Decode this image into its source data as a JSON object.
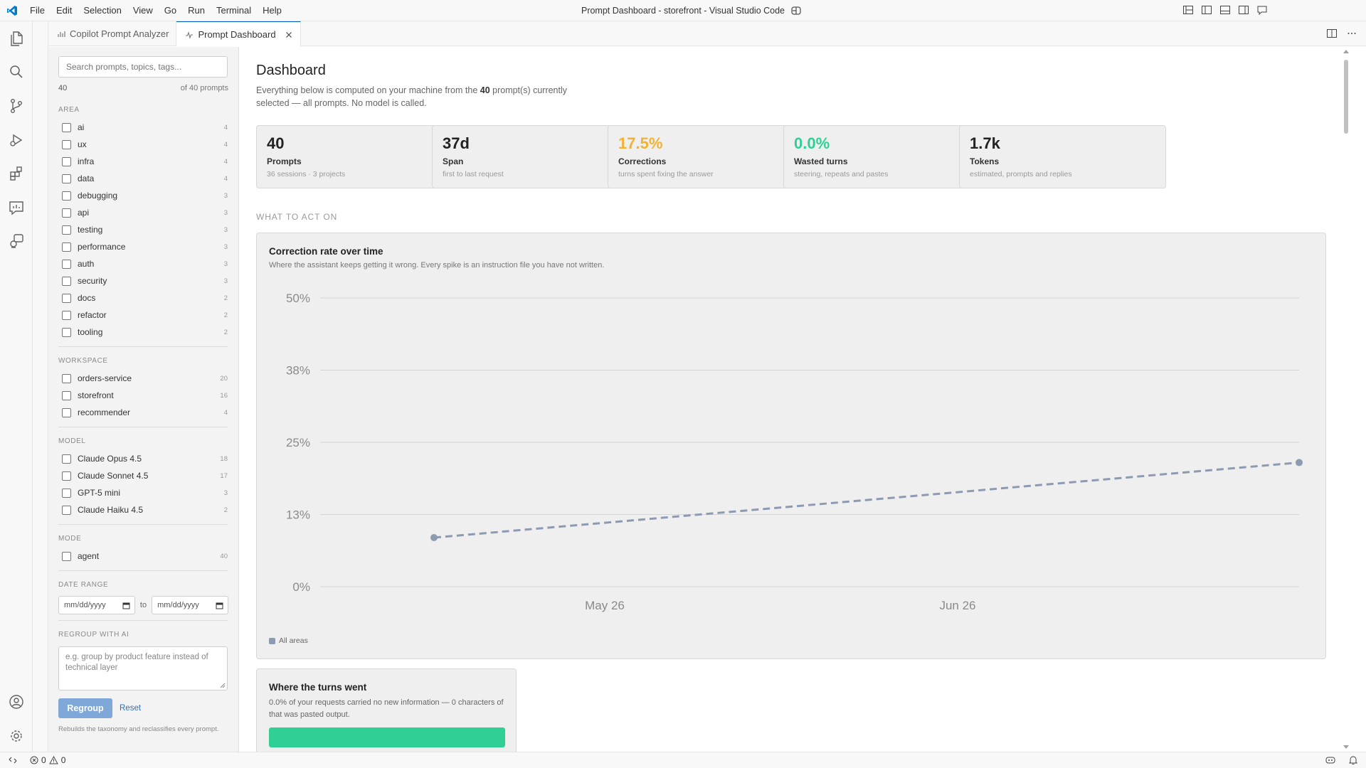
{
  "window": {
    "title": "Prompt Dashboard - storefront - Visual Studio Code",
    "menu": [
      "File",
      "Edit",
      "Selection",
      "View",
      "Go",
      "Run",
      "Terminal",
      "Help"
    ]
  },
  "tabs": [
    {
      "label": "Copilot Prompt Analyzer",
      "icon": "chart-icon",
      "active": false
    },
    {
      "label": "Prompt Dashboard",
      "icon": "pulse-icon",
      "active": true
    }
  ],
  "filters": {
    "search_placeholder": "Search prompts, topics, tags...",
    "selected_count": "40",
    "total_label": "of 40 prompts",
    "groups": [
      {
        "title": "AREA",
        "options": [
          {
            "label": "ai",
            "count": "4"
          },
          {
            "label": "ux",
            "count": "4"
          },
          {
            "label": "infra",
            "count": "4"
          },
          {
            "label": "data",
            "count": "4"
          },
          {
            "label": "debugging",
            "count": "3"
          },
          {
            "label": "api",
            "count": "3"
          },
          {
            "label": "testing",
            "count": "3"
          },
          {
            "label": "performance",
            "count": "3"
          },
          {
            "label": "auth",
            "count": "3"
          },
          {
            "label": "security",
            "count": "3"
          },
          {
            "label": "docs",
            "count": "2"
          },
          {
            "label": "refactor",
            "count": "2"
          },
          {
            "label": "tooling",
            "count": "2"
          }
        ]
      },
      {
        "title": "WORKSPACE",
        "options": [
          {
            "label": "orders-service",
            "count": "20"
          },
          {
            "label": "storefront",
            "count": "16"
          },
          {
            "label": "recommender",
            "count": "4"
          }
        ]
      },
      {
        "title": "MODEL",
        "options": [
          {
            "label": "Claude Opus 4.5",
            "count": "18"
          },
          {
            "label": "Claude Sonnet 4.5",
            "count": "17"
          },
          {
            "label": "GPT-5 mini",
            "count": "3"
          },
          {
            "label": "Claude Haiku 4.5",
            "count": "2"
          }
        ]
      },
      {
        "title": "MODE",
        "options": [
          {
            "label": "agent",
            "count": "40"
          }
        ]
      }
    ],
    "date_range": {
      "title": "DATE RANGE",
      "from_placeholder": "mm/dd/yyyy",
      "to_label": "to",
      "to_placeholder": "mm/dd/yyyy"
    },
    "regroup": {
      "title": "REGROUP WITH AI",
      "placeholder": "e.g. group by product feature instead of technical layer",
      "button": "Regroup",
      "reset": "Reset",
      "hint": "Rebuilds the taxonomy and reclassifies every prompt."
    }
  },
  "dashboard": {
    "title": "Dashboard",
    "subtitle_pre": "Everything below is computed on your machine from the ",
    "subtitle_count": "40",
    "subtitle_post": " prompt(s) currently selected — all prompts. No model is called.",
    "stats": [
      {
        "value": "40",
        "label": "Prompts",
        "desc": "36 sessions · 3 projects",
        "color": "#222222"
      },
      {
        "value": "37d",
        "label": "Span",
        "desc": "first to last request",
        "color": "#222222"
      },
      {
        "value": "17.5%",
        "label": "Corrections",
        "desc": "turns spent fixing the answer",
        "color": "#f2b233"
      },
      {
        "value": "0.0%",
        "label": "Wasted turns",
        "desc": "steering, repeats and pastes",
        "color": "#2fcf96"
      },
      {
        "value": "1.7k",
        "label": "Tokens",
        "desc": "estimated, prompts and replies",
        "color": "#222222"
      }
    ],
    "section_heading": "WHAT TO ACT ON",
    "correction_card": {
      "title": "Correction rate over time",
      "subtitle": "Where the assistant keeps getting it wrong. Every spike is an instruction file you have not written."
    },
    "turns_card": {
      "title": "Where the turns went",
      "subtitle": "0.0% of your requests carried no new information — 0 characters of that was pasted output.",
      "bar_fill": 1.0,
      "bar_color": "#2fcf96"
    }
  },
  "chart_data": {
    "type": "line",
    "title": "Correction rate over time",
    "y_ticks": [
      "50%",
      "38%",
      "25%",
      "13%",
      "0%"
    ],
    "y_tick_values": [
      50,
      38,
      25,
      13,
      0
    ],
    "ylim": [
      0,
      50
    ],
    "x_ticks": [
      "May 26",
      "Jun 26"
    ],
    "series": [
      {
        "name": "All areas",
        "color": "#8c9ab2",
        "style": "dashed",
        "points": [
          [
            "2025-05-11",
            8.5
          ],
          [
            "2025-07-26",
            21.5
          ]
        ]
      }
    ],
    "legend": "bottom-left",
    "grid": true
  },
  "statusbar": {
    "errors": "0",
    "warnings": "0"
  }
}
